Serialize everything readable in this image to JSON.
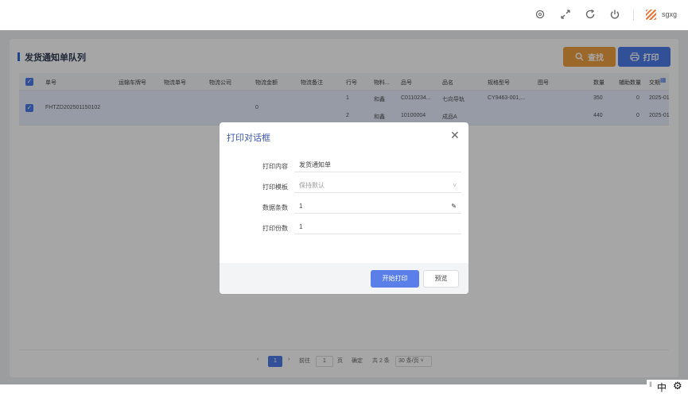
{
  "topbar": {
    "icons": [
      "settings-icon",
      "fullscreen-icon",
      "refresh-icon",
      "power-icon"
    ],
    "username": "sgxg"
  },
  "panel": {
    "title": "发货通知单队列",
    "search_label": "查找",
    "print_label": "打印"
  },
  "table": {
    "headers": [
      "单号",
      "运输车牌号",
      "物流单号",
      "物流公司",
      "物流金额",
      "物流备注",
      "行号",
      "物料...",
      "品号",
      "品名",
      "规格型号",
      "图号",
      "数量",
      "辅助数量",
      "交期"
    ],
    "row": {
      "order_no": "FHTZD202501150102",
      "logistics_amount": "0",
      "lines": [
        {
          "line_no": "1",
          "material": "和鑫",
          "part_no": "C0110234...",
          "name": "七向导轨",
          "spec": "CY9463-001,...",
          "qty": "350",
          "aux_qty": "0",
          "date": "2025-01"
        },
        {
          "line_no": "2",
          "material": "和鑫",
          "part_no": "10100004",
          "name": "成品A",
          "spec": "",
          "qty": "440",
          "aux_qty": "0",
          "date": "2025-01"
        }
      ]
    }
  },
  "pagination": {
    "current": "1",
    "goto_label": "前往",
    "page_input": "1",
    "page_unit": "页",
    "confirm": "确定",
    "total": "共 2 条",
    "page_size": "30 条/页"
  },
  "dialog": {
    "title": "打印对话框",
    "fields": [
      {
        "label": "打印内容",
        "value": "发货通知单"
      },
      {
        "label": "打印模板",
        "value": "保持默认"
      },
      {
        "label": "数据条数",
        "value": "1"
      },
      {
        "label": "打印份数",
        "value": "1"
      }
    ],
    "start_label": "开始打印",
    "preview_label": "预览"
  },
  "ime": {
    "mode": "中"
  }
}
